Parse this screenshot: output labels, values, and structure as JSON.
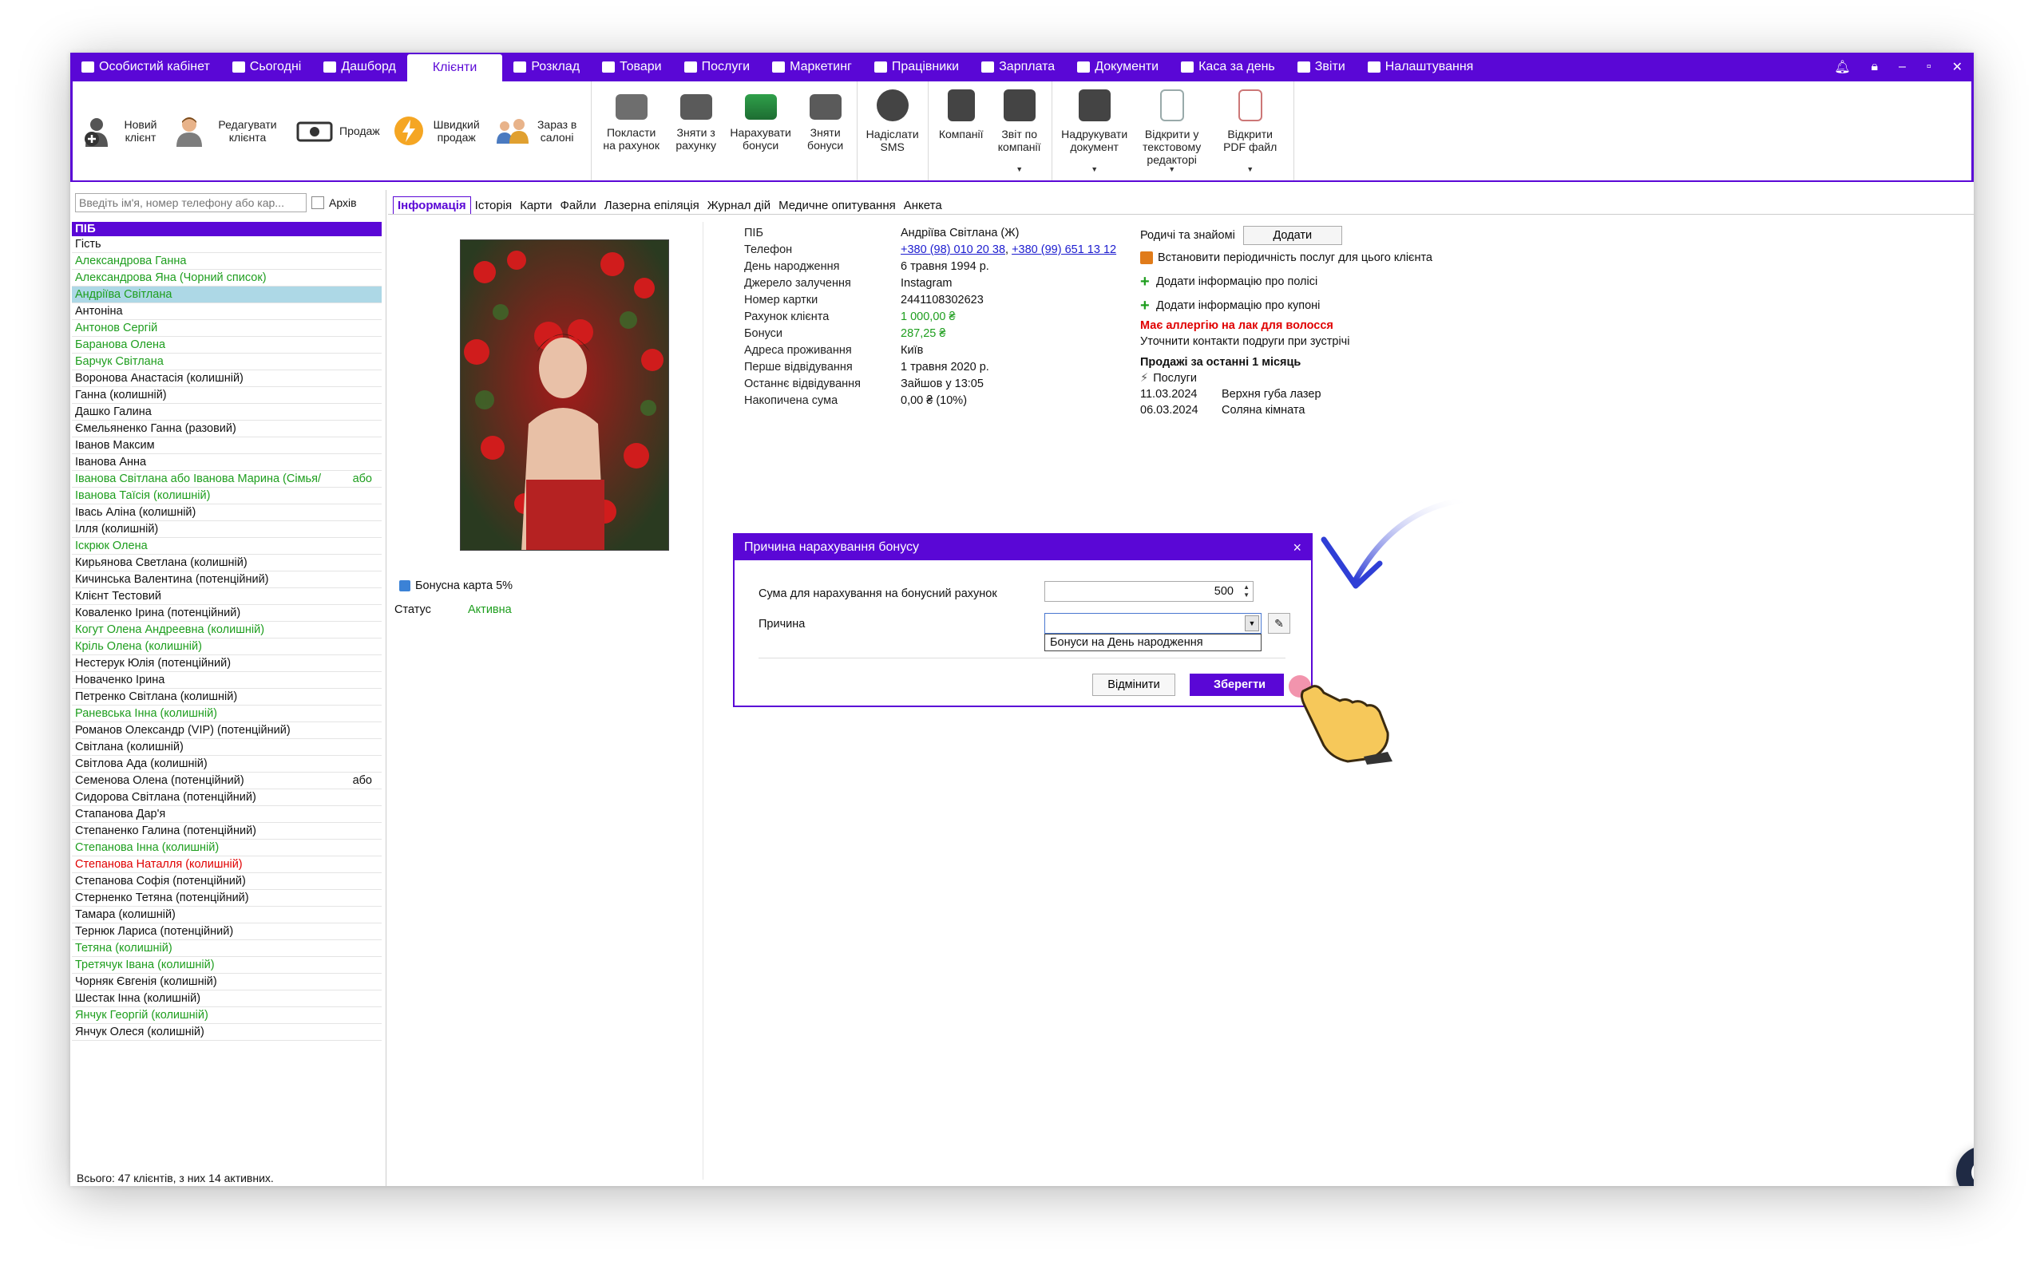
{
  "menu": {
    "items": [
      {
        "label": "Особистий кабінет",
        "icon": "wallet-icon"
      },
      {
        "label": "Сьогодні",
        "icon": "clock-icon"
      },
      {
        "label": "Дашборд",
        "icon": "pulse-icon"
      },
      {
        "label": "Клієнти",
        "icon": "",
        "active": true
      },
      {
        "label": "Розклад",
        "icon": "calendar-icon"
      },
      {
        "label": "Товари",
        "icon": "box-icon"
      },
      {
        "label": "Послуги",
        "icon": "lightning-icon"
      },
      {
        "label": "Маркетинг",
        "icon": "megaphone-icon"
      },
      {
        "label": "Працівники",
        "icon": "person-icon"
      },
      {
        "label": "Зарплата",
        "icon": "money-icon"
      },
      {
        "label": "Документи",
        "icon": "document-icon"
      },
      {
        "label": "Каса за день",
        "icon": "calculator-icon"
      },
      {
        "label": "Звіти",
        "icon": "bar-chart-icon"
      },
      {
        "label": "Налаштування",
        "icon": "gear-icon"
      }
    ]
  },
  "toolbar": {
    "new_client": "Новий клієнт",
    "edit_client": "Редагувати клієнта",
    "sale": "Продаж",
    "quick_sale": "Швидкий продаж",
    "in_salon": "Зараз в салоні",
    "put_on_account": "Покласти на рахунок",
    "withdraw_account": "Зняти з рахунку",
    "accrue_bonus": "Нарахувати бонуси",
    "withdraw_bonus": "Зняти бонуси",
    "send_sms": "Надіслати SMS",
    "companies": "Компанії",
    "company_report": "Звіт по компанії",
    "print_doc": "Надрукувати документ",
    "open_text_editor": "Відкрити у текстовому редакторі",
    "open_pdf": "Відкрити PDF файл"
  },
  "leftpanel": {
    "search_placeholder": "Введіть ім'я, номер телефону або кар...",
    "archive_label": "Архів",
    "header": "ПІБ",
    "footer": "Всього: 47 клієнтів, з них 14 активних."
  },
  "clients": [
    {
      "name": "Гість",
      "color": "#111111"
    },
    {
      "name": "Александрова Ганна",
      "color": "#1e9e1e"
    },
    {
      "name": "Александрова Яна (Чорний список)",
      "color": "#1e9e1e"
    },
    {
      "name": "Андріїва Світлана",
      "color": "#1e9e1e",
      "selected": true
    },
    {
      "name": "Антоніна",
      "color": "#111111"
    },
    {
      "name": "Антонов Сергій",
      "color": "#1e9e1e"
    },
    {
      "name": "Баранова Олена",
      "color": "#1e9e1e"
    },
    {
      "name": "Барчук Світлана",
      "color": "#1e9e1e"
    },
    {
      "name": "Воронова Анастасія (колишній)",
      "color": "#111111"
    },
    {
      "name": "Ганна (колишній)",
      "color": "#111111"
    },
    {
      "name": "Дашко Галина",
      "color": "#111111"
    },
    {
      "name": "Ємельяненко Ганна (разовий)",
      "color": "#111111"
    },
    {
      "name": "Іванов Максим",
      "color": "#111111"
    },
    {
      "name": "Іванова Анна",
      "color": "#111111"
    },
    {
      "name": "Іванова Світлана  або Іванова  Марина (Сімья/",
      "color": "#1e9e1e",
      "extra": "або"
    },
    {
      "name": "Іванова Таїсія (колишній)",
      "color": "#1e9e1e"
    },
    {
      "name": "Івась Аліна (колишній)",
      "color": "#111111"
    },
    {
      "name": "Ілля (колишній)",
      "color": "#111111"
    },
    {
      "name": "Іскрюк Олена",
      "color": "#1e9e1e"
    },
    {
      "name": "Кирьянова Светлана (колишній)",
      "color": "#111111"
    },
    {
      "name": "Кичинська Валентина (потенційний)",
      "color": "#111111"
    },
    {
      "name": "Клієнт Тестовий",
      "color": "#111111"
    },
    {
      "name": "Коваленко Ірина (потенційний)",
      "color": "#111111"
    },
    {
      "name": "Когут Олена Андреевна (колишній)",
      "color": "#1e9e1e"
    },
    {
      "name": "Кріль Олена (колишній)",
      "color": "#1e9e1e"
    },
    {
      "name": "Нестерук Юлія (потенційний)",
      "color": "#111111"
    },
    {
      "name": "Новаченко Ірина",
      "color": "#111111"
    },
    {
      "name": "Петренко Світлана (колишній)",
      "color": "#111111"
    },
    {
      "name": "Раневська Інна (колишній)",
      "color": "#1e9e1e"
    },
    {
      "name": "Романов Олександр (VIP) (потенційний)",
      "color": "#111111"
    },
    {
      "name": "Світлана (колишній)",
      "color": "#111111"
    },
    {
      "name": "Світлова Ада (колишній)",
      "color": "#111111"
    },
    {
      "name": "Семенова Олена (потенційний)",
      "color": "#111111",
      "extra": "або"
    },
    {
      "name": "Сидорова Світлана (потенційний)",
      "color": "#111111"
    },
    {
      "name": "Стапанова Дар'я",
      "color": "#111111"
    },
    {
      "name": "Степаненко Галина (потенційний)",
      "color": "#111111"
    },
    {
      "name": "Степанова Інна (колишній)",
      "color": "#1e9e1e"
    },
    {
      "name": "Степанова Наталля (колишній)",
      "color": "#e00000"
    },
    {
      "name": "Степанова Софія (потенційний)",
      "color": "#111111"
    },
    {
      "name": "Стерненко Тетяна (потенційний)",
      "color": "#111111"
    },
    {
      "name": "Тамара (колишній)",
      "color": "#111111"
    },
    {
      "name": "Тернюк Лариса (потенційний)",
      "color": "#111111"
    },
    {
      "name": "Тетяна (колишній)",
      "color": "#1e9e1e"
    },
    {
      "name": "Третячук Івана (колишній)",
      "color": "#1e9e1e"
    },
    {
      "name": "Чорняк Євгенія (колишній)",
      "color": "#111111"
    },
    {
      "name": "Шестак Інна (колишній)",
      "color": "#111111"
    },
    {
      "name": "Янчук Георгій (колишній)",
      "color": "#1e9e1e"
    },
    {
      "name": "Янчук Олеся (колишній)",
      "color": "#111111"
    }
  ],
  "tabs": [
    "Інформація",
    "Історія",
    "Карти",
    "Файли",
    "Лазерна епіляція",
    "Журнал дій",
    "Медичне опитування",
    "Анкета"
  ],
  "card": {
    "bonus_card": "Бонусна карта 5%",
    "status_label": "Статус",
    "status_value": "Активна"
  },
  "info": {
    "fullname_label": "ПІБ",
    "fullname": "Андріїва Світлана (Ж)",
    "phone_label": "Телефон",
    "phone1": "+380 (98) 010 20 38",
    "phone2": "+380 (99) 651 13 12",
    "birthday_label": "День народження",
    "birthday": "6 травня 1994 р.",
    "source_label": "Джерело залучення",
    "source": "Instagram",
    "card_label": "Номер картки",
    "card": "2441108302623",
    "account_label": "Рахунок клієнта",
    "account": "1 000,00 ₴",
    "bonus_label": "Бонуси",
    "bonus": "287,25 ₴",
    "address_label": "Адреса проживання",
    "address": "Київ",
    "first_visit_label": "Перше відвідування",
    "first_visit": "1 травня 2020 р.",
    "last_visit_label": "Останнє відвідування",
    "last_visit": "Зайшов у 13:05",
    "total_label": "Накопичена сума",
    "total": "0,00 ₴ (10%)"
  },
  "right": {
    "relatives_label": "Родичі та знайомі",
    "add_button": "Додати",
    "set_periodicity": "Встановити періодичність послуг для цього клієнта",
    "add_policy": "Додати інформацію про полісі",
    "add_coupon": "Додати інформацію про купоні",
    "allergy": "Має аллергію на лак для волосся",
    "note": "Уточнити контакти подруги при зустрічі",
    "sales_title": "Продажі за останні 1 місяць",
    "services_label": "Послуги",
    "sales": [
      {
        "date": "11.03.2024",
        "name": "Верхня губа лазер"
      },
      {
        "date": "06.03.2024",
        "name": "Соляна кімната"
      }
    ]
  },
  "dialog": {
    "title": "Причина нарахування бонусу",
    "close": "×",
    "sum_label": "Сума для нарахування на бонусний рахунок",
    "sum_value": "500",
    "reason_label": "Причина",
    "reason_option": "Бонуси на День народження",
    "cancel": "Відмінити",
    "save": "Зберегти"
  }
}
